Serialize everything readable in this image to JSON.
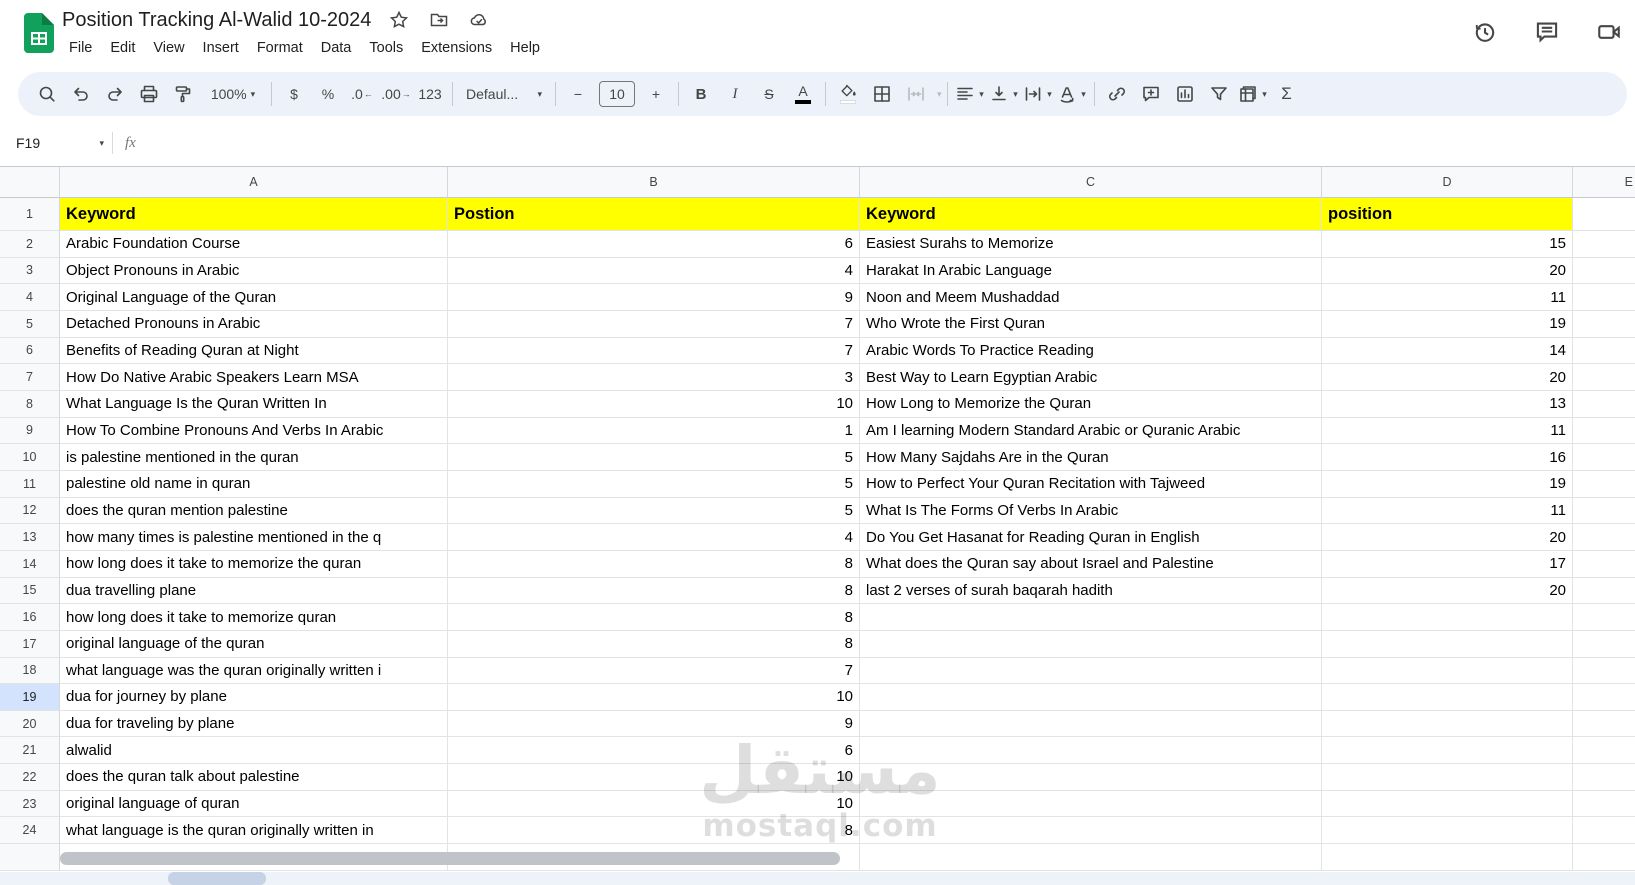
{
  "app": {
    "title": "Position Tracking Al-Walid 10-2024",
    "menus": [
      "File",
      "Edit",
      "View",
      "Insert",
      "Format",
      "Data",
      "Tools",
      "Extensions",
      "Help"
    ]
  },
  "icons": {
    "caret": "▾",
    "dec_arrow_left": "←",
    "dec_arrow_right": "→"
  },
  "toolbar": {
    "zoom": "100%",
    "currency_label": "$",
    "percent_label": "%",
    "decrease_decimal_label": ".0",
    "increase_decimal_label": ".00",
    "more_formats_label": "123",
    "font_name": "Defaul...",
    "font_size": "10",
    "decrease_font_label": "−",
    "increase_font_label": "+",
    "bold_label": "B",
    "italic_label": "I",
    "strikethrough_label": "S",
    "text_color_label": "A",
    "rotation_label": "A",
    "functions_label": "Σ"
  },
  "formula_bar": {
    "cell_reference": "F19",
    "fx_label": "fx"
  },
  "grid": {
    "column_letters": [
      "A",
      "B",
      "C",
      "D",
      "E"
    ],
    "row1_number": "1",
    "selected_row": 19,
    "header_bg": "#ffff00",
    "header_row": {
      "a": "Keyword",
      "b": "Postion",
      "c": "Keyword",
      "d": "position"
    },
    "rows": [
      {
        "n": 2,
        "a": "Arabic Foundation Course",
        "b": "6",
        "c": "Easiest Surahs to Memorize",
        "d": "15"
      },
      {
        "n": 3,
        "a": "Object Pronouns in Arabic",
        "b": "4",
        "c": "Harakat In Arabic Language",
        "d": "20"
      },
      {
        "n": 4,
        "a": "Original Language of the Quran",
        "b": "9",
        "c": "Noon and Meem Mushaddad",
        "d": "11"
      },
      {
        "n": 5,
        "a": "Detached Pronouns in Arabic",
        "b": "7",
        "c": "Who Wrote the First Quran",
        "d": "19"
      },
      {
        "n": 6,
        "a": "Benefits of Reading Quran at Night",
        "b": "7",
        "c": "Arabic Words To Practice Reading",
        "d": "14"
      },
      {
        "n": 7,
        "a": "How Do Native Arabic Speakers Learn MSA",
        "b": "3",
        "c": "Best Way to Learn Egyptian Arabic",
        "d": "20"
      },
      {
        "n": 8,
        "a": "What Language Is the Quran Written In",
        "b": "10",
        "c": "How Long to Memorize the Quran",
        "d": "13"
      },
      {
        "n": 9,
        "a": "How To Combine Pronouns And Verbs In Arabic",
        "b": "1",
        "c": "Am I learning Modern Standard Arabic or Quranic Arabic",
        "d": "11"
      },
      {
        "n": 10,
        "a": "is palestine mentioned in the quran",
        "b": "5",
        "c": "How Many Sajdahs Are in the Quran",
        "d": "16"
      },
      {
        "n": 11,
        "a": "palestine old name in quran",
        "b": "5",
        "c": "How to Perfect Your Quran Recitation with Tajweed",
        "d": "19"
      },
      {
        "n": 12,
        "a": "does the quran mention palestine",
        "b": "5",
        "c": "What Is The Forms Of Verbs In Arabic",
        "d": "11"
      },
      {
        "n": 13,
        "a": "how many times is palestine mentioned in the q",
        "b": "4",
        "c": "Do You Get Hasanat for Reading Quran in English",
        "d": "20"
      },
      {
        "n": 14,
        "a": "how long does it take to memorize the quran",
        "b": "8",
        "c": "What does the Quran say about Israel and Palestine",
        "d": "17"
      },
      {
        "n": 15,
        "a": "dua travelling plane",
        "b": "8",
        "c": "last 2 verses of surah baqarah hadith",
        "d": "20"
      },
      {
        "n": 16,
        "a": "how long does it take to memorize quran",
        "b": "8",
        "c": "",
        "d": ""
      },
      {
        "n": 17,
        "a": "original language of the quran",
        "b": "8",
        "c": "",
        "d": ""
      },
      {
        "n": 18,
        "a": "what language was the quran originally written i",
        "b": "7",
        "c": "",
        "d": ""
      },
      {
        "n": 19,
        "a": "dua for journey by plane",
        "b": "10",
        "c": "",
        "d": ""
      },
      {
        "n": 20,
        "a": "dua for traveling by plane",
        "b": "9",
        "c": "",
        "d": ""
      },
      {
        "n": 21,
        "a": "alwalid",
        "b": "6",
        "c": "",
        "d": ""
      },
      {
        "n": 22,
        "a": "does the quran talk about palestine",
        "b": "10",
        "c": "",
        "d": ""
      },
      {
        "n": 23,
        "a": "original language of quran",
        "b": "10",
        "c": "",
        "d": ""
      },
      {
        "n": 24,
        "a": "what language is the quran originally written in",
        "b": "8",
        "c": "",
        "d": ""
      },
      {
        "n": null,
        "a": "",
        "b": "",
        "c": "",
        "d": ""
      }
    ]
  },
  "watermark": {
    "arabic": "مستقل",
    "latin": "mostaql.com"
  },
  "colors": {
    "header_yellow": "#ffff00",
    "toolbar_bg": "#edf2fa",
    "selected_row_bg": "#d3e3fd",
    "grid_line": "#e2e3e3",
    "logo_green": "#12a15c"
  }
}
